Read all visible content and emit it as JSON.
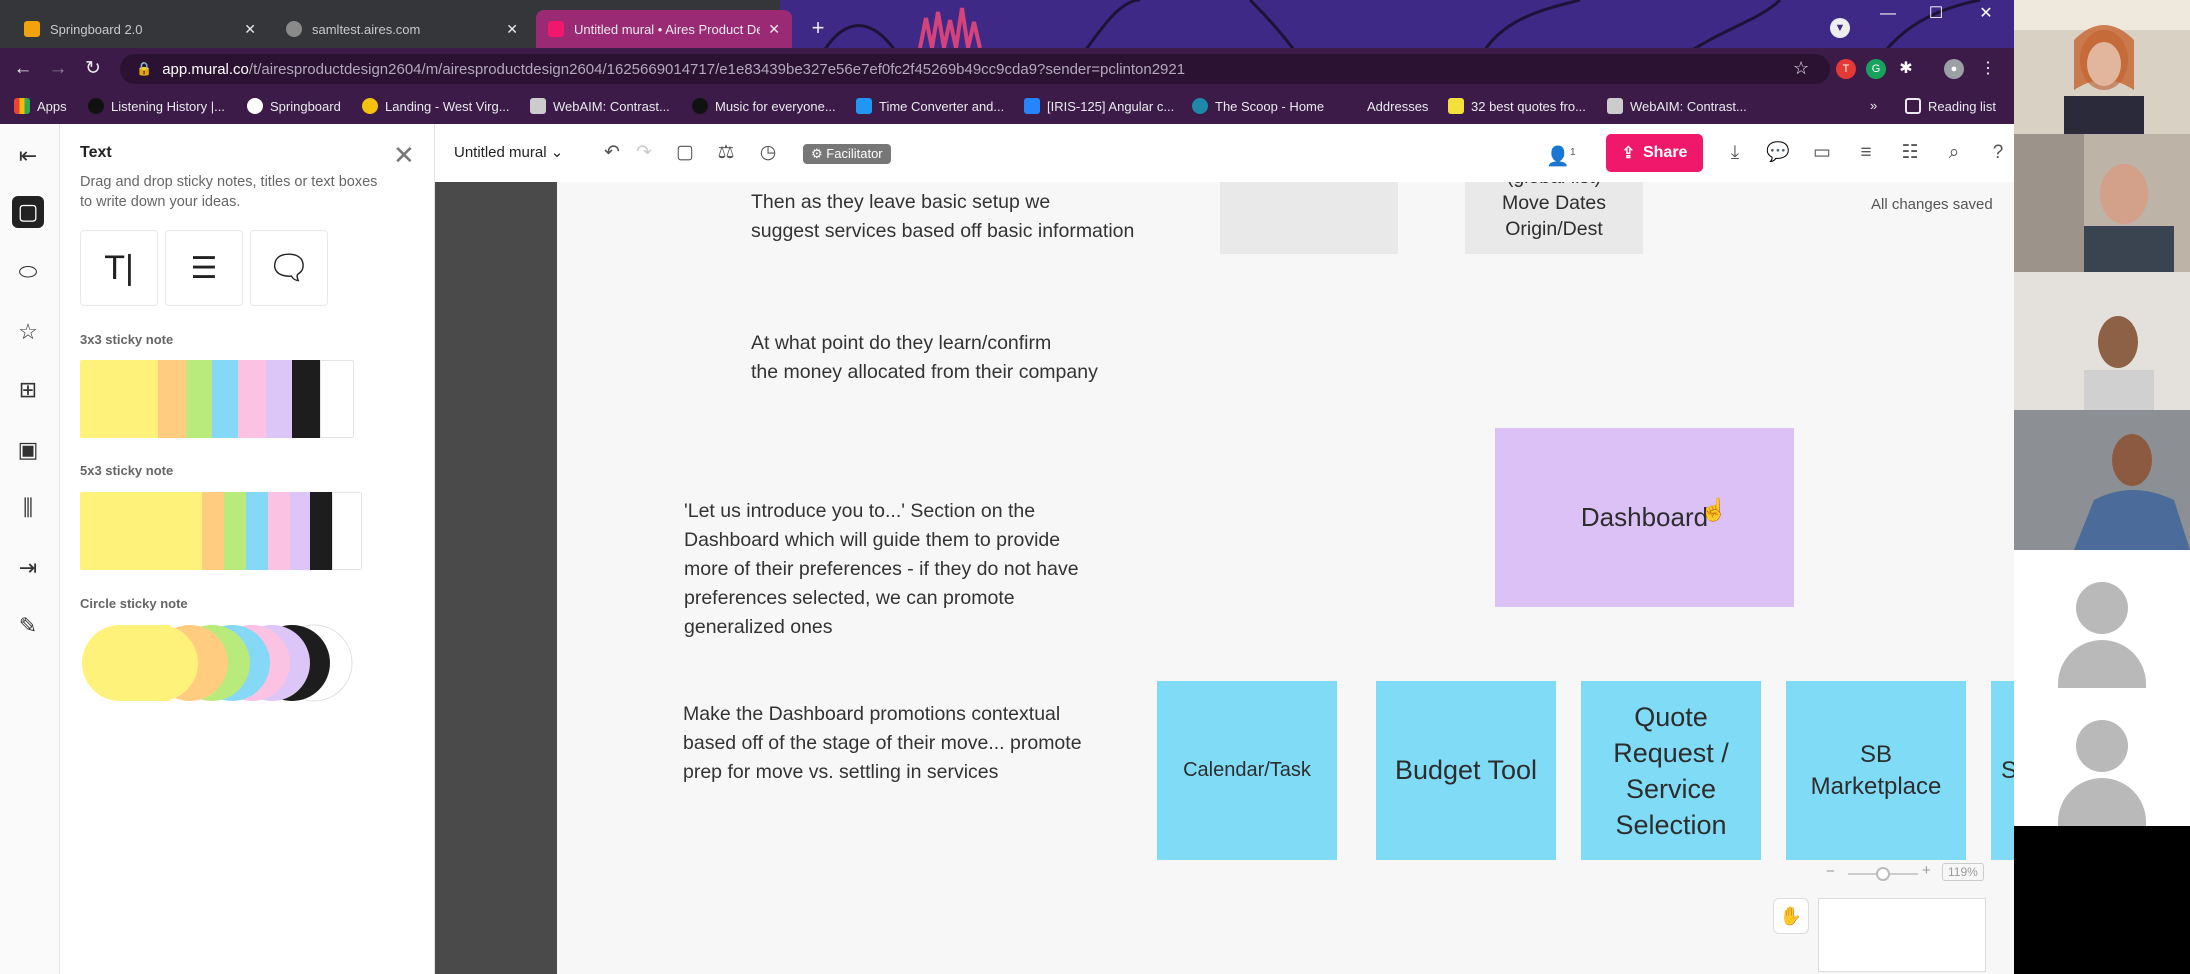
{
  "browser": {
    "tabs": [
      {
        "title": "Springboard 2.0",
        "color": "#f0a30a"
      },
      {
        "title": "samltest.aires.com",
        "color": "#8a8a8a"
      },
      {
        "title": "Untitled mural • Aires Product De",
        "color": "#f0186b"
      }
    ],
    "url_host": "app.mural.co",
    "url_path": "/t/airesproductdesign2604/m/airesproductdesign2604/1625669014717/e1e83439be327e56e7ef0fc2f45269b49cc9cda9?sender=pclinton2921",
    "bookmarks": [
      "Apps",
      "Listening History |...",
      "Springboard",
      "Landing - West Virg...",
      "WebAIM: Contrast...",
      "Music for everyone...",
      "Time Converter and...",
      "[IRIS-125] Angular c...",
      "The Scoop - Home",
      "Addresses",
      "32 best quotes fro...",
      "WebAIM: Contrast..."
    ],
    "reading_list": "Reading list"
  },
  "panel": {
    "title": "Text",
    "description": "Drag and drop sticky notes, titles or text boxes to write down your ideas.",
    "section_3x3": "3x3 sticky note",
    "section_5x3": "5x3 sticky note",
    "section_circle": "Circle sticky note"
  },
  "mural": {
    "title": "Untitled mural",
    "facilitator": "Facilitator",
    "share": "Share",
    "user_count": "1",
    "saved_status": "All changes saved",
    "zoom": "119%"
  },
  "canvas": {
    "text_blocks": [
      [
        "Then as they leave basic setup we",
        "suggest services based off basic information"
      ],
      [
        "At what point do they learn/confirm",
        "the money allocated from their company"
      ],
      [
        "'Let us introduce you to...'  Section on the",
        "Dashboard which will guide them to provide",
        "more of their preferences - if they do not have",
        "preferences selected, we can promote",
        "generalized ones"
      ],
      [
        "Make the Dashboard promotions contextual",
        "based off of the stage of their move... promote",
        "prep for move vs. settling in services"
      ]
    ],
    "sticky_top_partial": [
      "(global list)",
      "Move Dates",
      "Origin/Dest"
    ],
    "sticky_dashboard": "Dashboard",
    "blue_stickies": [
      "Calendar/Task",
      "Budget Tool",
      "Quote Request / Service Selection",
      "SB Marketplace",
      "S"
    ]
  }
}
